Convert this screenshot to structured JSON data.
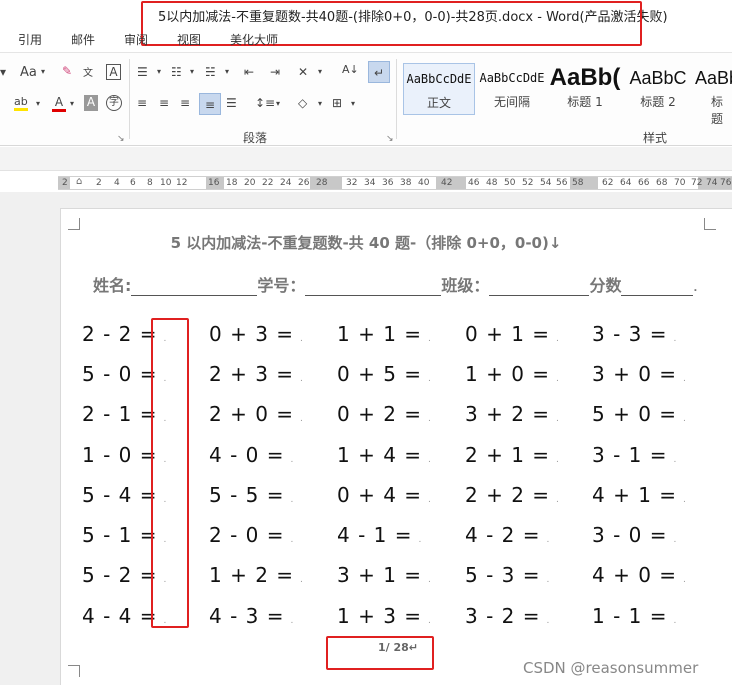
{
  "window": {
    "title": "5以内加减法-不重复题数-共40题-(排除0+0，0-0)-共28页.docx - Word(产品激活失败)"
  },
  "tabs": [
    "引用",
    "邮件",
    "审阅",
    "视图",
    "美化大师"
  ],
  "ribbon": {
    "paragraph_group_label": "段落",
    "styles_group_label": "样式",
    "styles": [
      {
        "sample": "AaBbCcDdE",
        "name": "正文",
        "selected": true
      },
      {
        "sample": "AaBbCcDdE",
        "name": "无间隔",
        "selected": false
      },
      {
        "sample": "AaBb(",
        "name": "标题 1",
        "selected": false
      },
      {
        "sample": "AaBbC",
        "name": "标题 2",
        "selected": false
      },
      {
        "sample": "AaBb",
        "name": "标题",
        "selected": false
      }
    ],
    "font_size_icon": "Aa",
    "font_color_icon": "A",
    "char_border_icon": "A",
    "phonetic_icon": "字"
  },
  "ruler": {
    "numbers": [
      "2",
      "2",
      "2",
      "4",
      "6",
      "8",
      "10",
      "12",
      "16",
      "18",
      "20",
      "22",
      "24",
      "26",
      "28",
      "32",
      "34",
      "36",
      "38",
      "40",
      "42",
      "46",
      "48",
      "50",
      "52",
      "54",
      "56",
      "58",
      "62",
      "64",
      "66",
      "68",
      "70",
      "72",
      "74",
      "76"
    ]
  },
  "document": {
    "title": "5 以内加减法-不重复题数-共 40 题-（排除 0+0，0-0)↓",
    "fields": {
      "name_label": "姓名:",
      "id_label": "学号：",
      "class_label": "班级：",
      "score_label": "分数",
      "end_mark": "."
    },
    "columns": [
      [
        "2 - 2 =",
        "5 - 0 =",
        "2 - 1 =",
        "1 - 0 =",
        "5 - 4 =",
        "5 - 1 =",
        "5 - 2 =",
        "4 - 4 ="
      ],
      [
        "0 + 3 =",
        "2 + 3 =",
        "2 + 0 =",
        "4 - 0 =",
        "5 - 5 =",
        "2 - 0 =",
        "1 + 2 =",
        "4 - 3 ="
      ],
      [
        "1 + 1 =",
        "0 + 5 =",
        "0 + 2 =",
        "1 + 4 =",
        "0 + 4 =",
        "4 - 1 =",
        "3 + 1 =",
        "1 + 3 ="
      ],
      [
        "0 + 1 =",
        "1 + 0 =",
        "3 + 2 =",
        "2 + 1 =",
        "2 + 2 =",
        "4 - 2 =",
        "5 - 3 =",
        "3 - 2 ="
      ],
      [
        "3 - 3 =",
        "3 + 0 =",
        "5 + 0 =",
        "3 - 1 =",
        "4 + 1 =",
        "3 - 0 =",
        "4 + 0 =",
        "1 - 1 ="
      ]
    ],
    "paragraph_mark": ".",
    "page_number": "1/ 28↵"
  },
  "watermark": "CSDN @reasonsummer",
  "highlight_color": "#e02020"
}
